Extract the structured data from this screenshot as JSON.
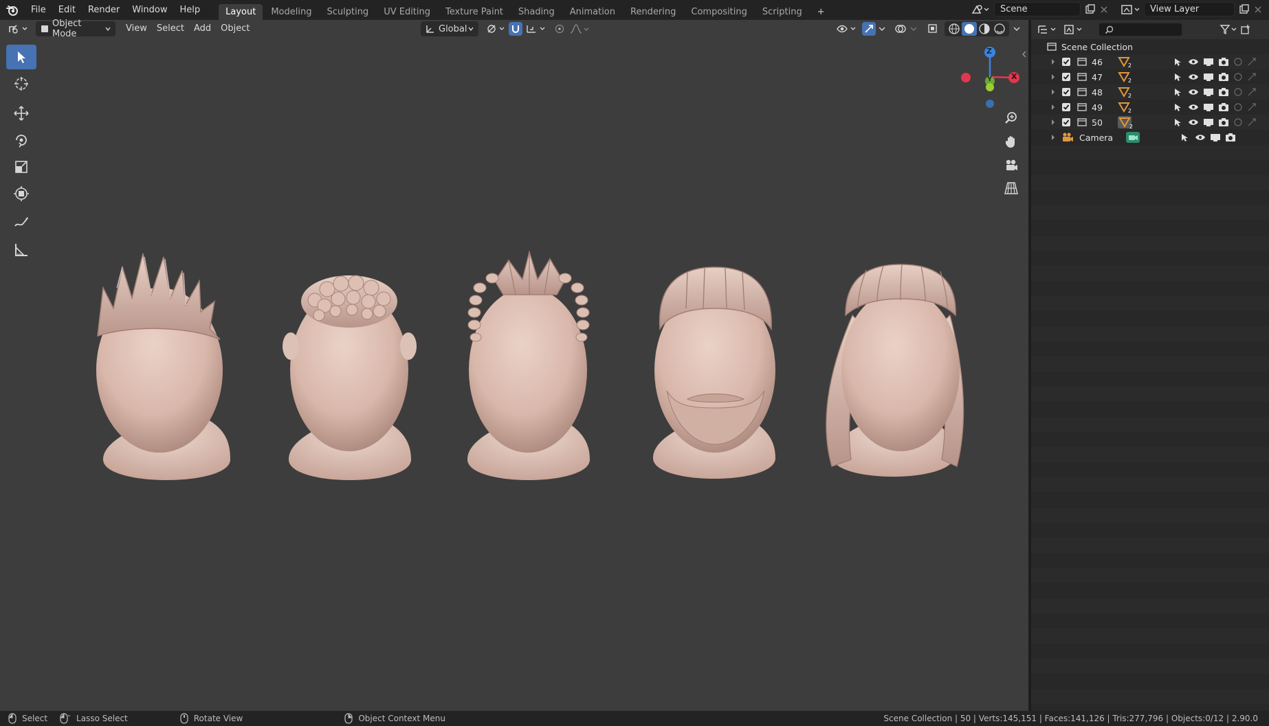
{
  "topbar": {
    "menus": [
      "File",
      "Edit",
      "Render",
      "Window",
      "Help"
    ],
    "workspaces": [
      "Layout",
      "Modeling",
      "Sculpting",
      "UV Editing",
      "Texture Paint",
      "Shading",
      "Animation",
      "Rendering",
      "Compositing",
      "Scripting"
    ],
    "active_workspace": "Layout",
    "add_workspace": "+",
    "scene_name": "Scene",
    "view_layer": "View Layer"
  },
  "viewport_header": {
    "mode": "Object Mode",
    "menus": [
      "View",
      "Select",
      "Add",
      "Object"
    ],
    "orientation": "Global"
  },
  "gizmo": {
    "z": "Z",
    "y": "Y",
    "x": "X"
  },
  "outliner": {
    "root": "Scene Collection",
    "collections": [
      {
        "name": "46",
        "badge": "2"
      },
      {
        "name": "47",
        "badge": "2"
      },
      {
        "name": "48",
        "badge": "2"
      },
      {
        "name": "49",
        "badge": "2"
      },
      {
        "name": "50",
        "badge": "2"
      }
    ],
    "camera": "Camera"
  },
  "statusbar": {
    "select": "Select",
    "lasso": "Lasso Select",
    "rotate": "Rotate View",
    "context": "Object Context Menu",
    "stats": "Scene Collection | 50 | Verts:145,151 | Faces:141,126 | Tris:277,796 | Objects:0/12 | 2.90.0"
  },
  "colors": {
    "accent": "#4772b3",
    "viewport_bg": "#3d3d3d",
    "head_skin": "#d9b7ab",
    "axis_x": "#e2374e",
    "axis_y": "#6ba836",
    "axis_z": "#3b83e1",
    "collection_icon": "#e0973d"
  }
}
